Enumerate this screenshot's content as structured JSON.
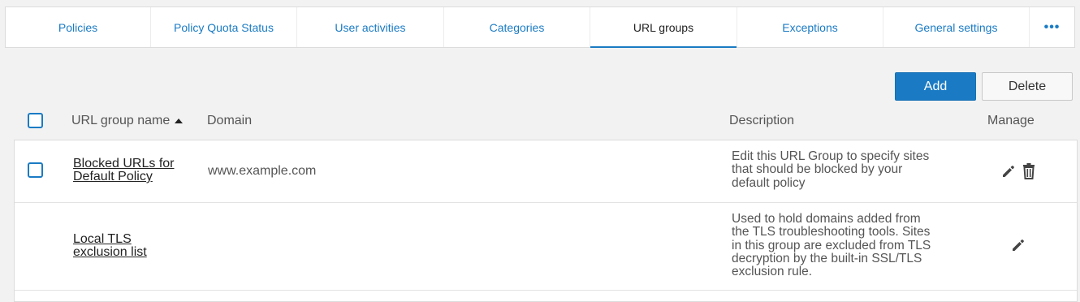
{
  "tabs": [
    {
      "label": "Policies",
      "active": false
    },
    {
      "label": "Policy Quota Status",
      "active": false
    },
    {
      "label": "User activities",
      "active": false
    },
    {
      "label": "Categories",
      "active": false
    },
    {
      "label": "URL groups",
      "active": true
    },
    {
      "label": "Exceptions",
      "active": false
    },
    {
      "label": "General settings",
      "active": false
    }
  ],
  "more_label": "•••",
  "actions": {
    "add_label": "Add",
    "delete_label": "Delete"
  },
  "columns": {
    "name": "URL group name",
    "domain": "Domain",
    "description": "Description",
    "manage": "Manage"
  },
  "rows": [
    {
      "name_line1": "Blocked URLs for",
      "name_line2": "Default Policy",
      "domain": "www.example.com",
      "desc_lines": [
        "Edit this URL Group to specify sites",
        "that should be blocked by your",
        "default policy"
      ],
      "selectable": true,
      "deletable": true
    },
    {
      "name_line1": "Local TLS",
      "name_line2": "exclusion list",
      "domain": "",
      "desc_lines": [
        "Used to hold domains added from",
        "the TLS troubleshooting tools. Sites",
        "in this group are excluded from TLS",
        "decryption by the built-in SSL/TLS",
        "exclusion rule."
      ],
      "selectable": false,
      "deletable": false
    }
  ],
  "colors": {
    "accent": "#1a7bc4",
    "background": "#f2f2f2"
  },
  "icons": {
    "edit": "pencil-icon",
    "delete": "trash-icon",
    "sort": "sort-ascending-icon"
  }
}
